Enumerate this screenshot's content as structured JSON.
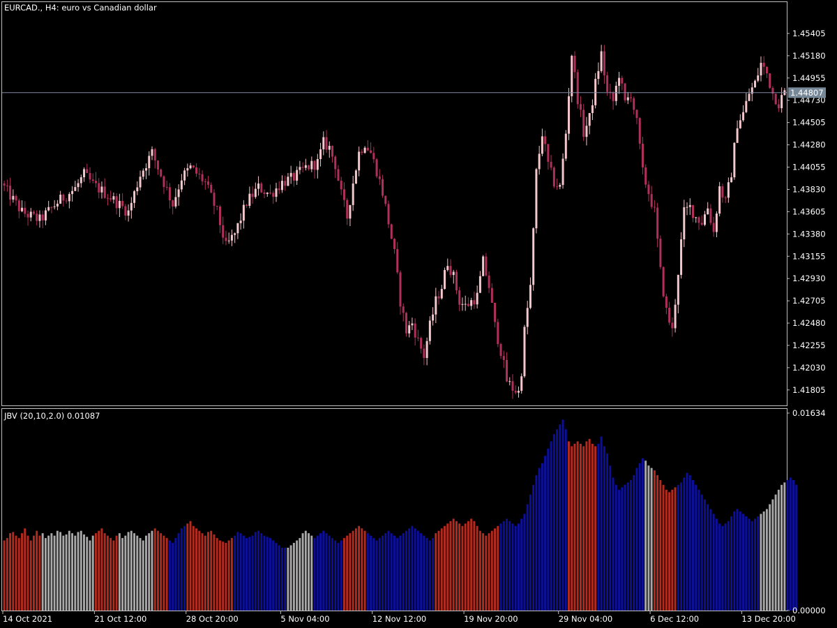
{
  "window": {
    "symbol_title": "EURCAD., H4:  euro vs Canadian dollar",
    "indicator_title": "JBV (20,10,2.0) 0.01087"
  },
  "colors": {
    "background": "#000000",
    "frame": "#c0c0c0",
    "bull_candle": "#f4c7cc",
    "bear_candle": "#b0305a",
    "bid_line": "#7f8aa0",
    "bid_tag": "#778899",
    "hist_blue": "#0b0f9c",
    "hist_red": "#b52a1d",
    "hist_gray": "#a8a8a8"
  },
  "chart_data": [
    {
      "type": "candlestick",
      "title": "EURCAD., H4:  euro vs Canadian dollar",
      "ylim": [
        1.4167,
        1.4563
      ],
      "y_ticks": [
        "1.45405",
        "1.45180",
        "1.44955",
        "1.44730",
        "1.44505",
        "1.44280",
        "1.44055",
        "1.43830",
        "1.43605",
        "1.43380",
        "1.43155",
        "1.42930",
        "1.42705",
        "1.42480",
        "1.42255",
        "1.42030",
        "1.41805"
      ],
      "current_price": "1.44807",
      "x_ticks": [
        "14 Oct 2021",
        "21 Oct 12:00",
        "28 Oct 20:00",
        "5 Nov 04:00",
        "12 Nov 12:00",
        "19 Nov 20:00",
        "29 Nov 04:00",
        "6 Dec 12:00",
        "13 Dec 20:00"
      ],
      "close_path": [
        [
          0,
          1.4385
        ],
        [
          6,
          1.436
        ],
        [
          12,
          1.4352
        ],
        [
          18,
          1.437
        ],
        [
          24,
          1.4384
        ],
        [
          27,
          1.4398
        ],
        [
          30,
          1.4388
        ],
        [
          36,
          1.4375
        ],
        [
          42,
          1.436
        ],
        [
          46,
          1.4398
        ],
        [
          50,
          1.442
        ],
        [
          54,
          1.439
        ],
        [
          57,
          1.4368
        ],
        [
          60,
          1.4395
        ],
        [
          63,
          1.4405
        ],
        [
          68,
          1.439
        ],
        [
          72,
          1.436
        ],
        [
          75,
          1.4325
        ],
        [
          78,
          1.4338
        ],
        [
          82,
          1.437
        ],
        [
          86,
          1.4385
        ],
        [
          90,
          1.4378
        ],
        [
          94,
          1.439
        ],
        [
          98,
          1.4395
        ],
        [
          102,
          1.4405
        ],
        [
          106,
          1.441
        ],
        [
          108,
          1.443
        ],
        [
          110,
          1.4425
        ],
        [
          112,
          1.4408
        ],
        [
          114,
          1.4378
        ],
        [
          116,
          1.4355
        ],
        [
          118,
          1.439
        ],
        [
          120,
          1.442
        ],
        [
          122,
          1.443
        ],
        [
          124,
          1.442
        ],
        [
          126,
          1.4402
        ],
        [
          128,
          1.438
        ],
        [
          130,
          1.435
        ],
        [
          132,
          1.4318
        ],
        [
          134,
          1.427
        ],
        [
          136,
          1.424
        ],
        [
          138,
          1.4248
        ],
        [
          140,
          1.423
        ],
        [
          142,
          1.4215
        ],
        [
          144,
          1.4245
        ],
        [
          146,
          1.427
        ],
        [
          148,
          1.4285
        ],
        [
          150,
          1.431
        ],
        [
          152,
          1.4295
        ],
        [
          154,
          1.427
        ],
        [
          156,
          1.4265
        ],
        [
          158,
          1.427
        ],
        [
          160,
          1.4275
        ],
        [
          162,
          1.431
        ],
        [
          164,
          1.4285
        ],
        [
          166,
          1.4245
        ],
        [
          168,
          1.422
        ],
        [
          170,
          1.419
        ],
        [
          172,
          1.4182
        ],
        [
          174,
          1.4178
        ],
        [
          175,
          1.42
        ],
        [
          176,
          1.424
        ],
        [
          178,
          1.4285
        ],
        [
          179,
          1.434
        ],
        [
          180,
          1.44
        ],
        [
          182,
          1.444
        ],
        [
          184,
          1.4408
        ],
        [
          186,
          1.439
        ],
        [
          188,
          1.4385
        ],
        [
          190,
          1.444
        ],
        [
          192,
          1.452
        ],
        [
          194,
          1.4475
        ],
        [
          196,
          1.444
        ],
        [
          198,
          1.4455
        ],
        [
          200,
          1.449
        ],
        [
          202,
          1.452
        ],
        [
          204,
          1.448
        ],
        [
          206,
          1.4472
        ],
        [
          208,
          1.45
        ],
        [
          210,
          1.447
        ],
        [
          212,
          1.448
        ],
        [
          214,
          1.445
        ],
        [
          216,
          1.44
        ],
        [
          218,
          1.438
        ],
        [
          220,
          1.436
        ],
        [
          222,
          1.43
        ],
        [
          224,
          1.426
        ],
        [
          226,
          1.424
        ],
        [
          228,
          1.43
        ],
        [
          230,
          1.436
        ],
        [
          232,
          1.4365
        ],
        [
          234,
          1.4355
        ],
        [
          236,
          1.435
        ],
        [
          238,
          1.4365
        ],
        [
          240,
          1.434
        ],
        [
          242,
          1.4385
        ],
        [
          244,
          1.437
        ],
        [
          246,
          1.44
        ],
        [
          248,
          1.445
        ],
        [
          250,
          1.446
        ],
        [
          252,
          1.448
        ],
        [
          254,
          1.449
        ],
        [
          256,
          1.451
        ],
        [
          258,
          1.45
        ],
        [
          260,
          1.448
        ],
        [
          262,
          1.447
        ],
        [
          264,
          1.4481
        ]
      ]
    },
    {
      "type": "bar",
      "title": "JBV (20,10,2.0) 0.01087",
      "ylim": [
        0.0,
        0.01634
      ],
      "y_ticks": [
        "0.01634",
        "0.00000"
      ],
      "bar_count": 265,
      "values": [
        0.0058,
        0.006,
        0.0064,
        0.0065,
        0.0062,
        0.006,
        0.0064,
        0.0068,
        0.0062,
        0.0058,
        0.0062,
        0.0066,
        0.0062,
        0.0064,
        0.006,
        0.0062,
        0.0064,
        0.0062,
        0.0066,
        0.0065,
        0.0062,
        0.0063,
        0.0066,
        0.0064,
        0.0062,
        0.0065,
        0.0066,
        0.0063,
        0.0061,
        0.0058,
        0.0062,
        0.0064,
        0.0066,
        0.0068,
        0.0064,
        0.0062,
        0.006,
        0.0058,
        0.0062,
        0.0064,
        0.006,
        0.0062,
        0.0065,
        0.0066,
        0.0064,
        0.0062,
        0.006,
        0.0058,
        0.0062,
        0.0064,
        0.0066,
        0.0068,
        0.0066,
        0.0064,
        0.0062,
        0.006,
        0.0058,
        0.0056,
        0.006,
        0.0064,
        0.0068,
        0.007,
        0.0072,
        0.0074,
        0.007,
        0.0068,
        0.0066,
        0.0064,
        0.0062,
        0.0065,
        0.0066,
        0.0063,
        0.006,
        0.0058,
        0.0057,
        0.0056,
        0.0058,
        0.006,
        0.0062,
        0.0065,
        0.0064,
        0.0062,
        0.006,
        0.0061,
        0.0062,
        0.0065,
        0.0066,
        0.0064,
        0.0062,
        0.0061,
        0.006,
        0.0058,
        0.0056,
        0.0054,
        0.0052,
        0.0052,
        0.0052,
        0.0054,
        0.0056,
        0.0058,
        0.006,
        0.0064,
        0.0066,
        0.0064,
        0.0062,
        0.006,
        0.0062,
        0.0064,
        0.0066,
        0.0064,
        0.0062,
        0.006,
        0.0058,
        0.0056,
        0.0058,
        0.006,
        0.0062,
        0.0064,
        0.0066,
        0.0068,
        0.007,
        0.0068,
        0.0066,
        0.0064,
        0.0062,
        0.006,
        0.0058,
        0.006,
        0.0062,
        0.0064,
        0.0066,
        0.0064,
        0.0062,
        0.006,
        0.0062,
        0.0064,
        0.0066,
        0.0068,
        0.007,
        0.0068,
        0.0066,
        0.0064,
        0.0062,
        0.006,
        0.0058,
        0.006,
        0.0064,
        0.0066,
        0.0068,
        0.007,
        0.0072,
        0.0074,
        0.0076,
        0.0074,
        0.0072,
        0.007,
        0.0072,
        0.0074,
        0.0076,
        0.0074,
        0.007,
        0.0066,
        0.0064,
        0.0062,
        0.0064,
        0.0066,
        0.0068,
        0.007,
        0.0072,
        0.0074,
        0.0076,
        0.0074,
        0.0072,
        0.007,
        0.0072,
        0.0076,
        0.008,
        0.0088,
        0.0096,
        0.0104,
        0.0112,
        0.0118,
        0.0122,
        0.0128,
        0.0134,
        0.014,
        0.0146,
        0.015,
        0.0154,
        0.0158,
        0.015,
        0.014,
        0.0136,
        0.0138,
        0.014,
        0.0138,
        0.0136,
        0.014,
        0.0142,
        0.0138,
        0.0136,
        0.0138,
        0.0144,
        0.0136,
        0.013,
        0.012,
        0.011,
        0.0104,
        0.01,
        0.0102,
        0.0104,
        0.0106,
        0.0108,
        0.0112,
        0.0118,
        0.0122,
        0.0126,
        0.0124,
        0.012,
        0.0118,
        0.0116,
        0.0112,
        0.0108,
        0.0104,
        0.01,
        0.0098,
        0.01,
        0.0102,
        0.0104,
        0.0106,
        0.011,
        0.0114,
        0.0112,
        0.0108,
        0.0104,
        0.01,
        0.0096,
        0.0092,
        0.0088,
        0.0084,
        0.008,
        0.0076,
        0.0072,
        0.007,
        0.0072,
        0.0074,
        0.0078,
        0.0082,
        0.0084,
        0.0082,
        0.008,
        0.0078,
        0.0076,
        0.0074,
        0.0076,
        0.0078,
        0.008,
        0.0082,
        0.0084,
        0.0088,
        0.0092,
        0.0096,
        0.01,
        0.0104,
        0.0106,
        0.0108,
        0.011,
        0.0108,
        0.0104
      ],
      "segments": [
        {
          "from": 0,
          "to": 12,
          "color": "red"
        },
        {
          "from": 13,
          "to": 20,
          "color": "gray"
        },
        {
          "from": 21,
          "to": 30,
          "color": "gray"
        },
        {
          "from": 31,
          "to": 38,
          "color": "red"
        },
        {
          "from": 39,
          "to": 50,
          "color": "gray"
        },
        {
          "from": 51,
          "to": 55,
          "color": "red"
        },
        {
          "from": 56,
          "to": 61,
          "color": "blue"
        },
        {
          "from": 62,
          "to": 77,
          "color": "red"
        },
        {
          "from": 78,
          "to": 95,
          "color": "blue"
        },
        {
          "from": 96,
          "to": 104,
          "color": "gray"
        },
        {
          "from": 105,
          "to": 114,
          "color": "blue"
        },
        {
          "from": 115,
          "to": 122,
          "color": "red"
        },
        {
          "from": 123,
          "to": 145,
          "color": "blue"
        },
        {
          "from": 146,
          "to": 167,
          "color": "red"
        },
        {
          "from": 168,
          "to": 190,
          "color": "blue"
        },
        {
          "from": 191,
          "to": 200,
          "color": "red"
        },
        {
          "from": 201,
          "to": 216,
          "color": "blue"
        },
        {
          "from": 217,
          "to": 219,
          "color": "gray"
        },
        {
          "from": 220,
          "to": 227,
          "color": "red"
        },
        {
          "from": 228,
          "to": 236,
          "color": "blue"
        },
        {
          "from": 237,
          "to": 255,
          "color": "blue"
        },
        {
          "from": 256,
          "to": 264,
          "color": "gray"
        }
      ]
    }
  ]
}
